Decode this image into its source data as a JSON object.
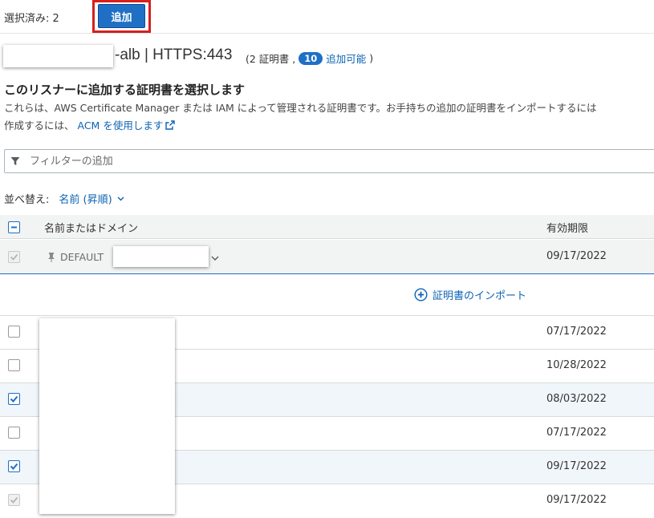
{
  "toolbar": {
    "selected_count": "選択済み: 2",
    "add_label": "追加"
  },
  "listener": {
    "name_suffix": "-alb | HTTPS:443",
    "cert_prefix": "(2 証明書 ,",
    "available_count": "10",
    "available_link": "追加可能",
    "cert_suffix": ")"
  },
  "section": {
    "title": "このリスナーに追加する証明書を選択します",
    "desc_line1": "これらは、AWS Certificate Manager または IAM によって管理される証明書です。お手持ちの追加の証明書をインポートするには",
    "desc_line2_prefix": "作成するには、",
    "acm_link": "ACM を使用します"
  },
  "filter": {
    "placeholder": "フィルターの追加"
  },
  "sort": {
    "label": "並べ替え:",
    "value": "名前 (昇順)"
  },
  "table": {
    "col_name": "名前またはドメイン",
    "col_expiration": "有効期限",
    "default_row": {
      "label": "DEFAULT",
      "expiration": "09/17/2022"
    },
    "import_label": "証明書のインポート",
    "rows": [
      {
        "expiration": "07/17/2022",
        "checked": false,
        "disabled": false
      },
      {
        "expiration": "10/28/2022",
        "checked": false,
        "disabled": false
      },
      {
        "expiration": "08/03/2022",
        "checked": true,
        "disabled": false
      },
      {
        "expiration": "07/17/2022",
        "checked": false,
        "disabled": false
      },
      {
        "expiration": "09/17/2022",
        "checked": true,
        "disabled": false
      },
      {
        "expiration": "09/17/2022",
        "checked": true,
        "disabled": true
      }
    ]
  },
  "colors": {
    "primary": "#1f6fc5",
    "link": "#0d63b3",
    "highlight_border": "#d61f1f",
    "selected_row": "#f1f6fb"
  },
  "icons": {
    "filter": "filter-icon",
    "external_link": "external-link-icon",
    "chevron": "chevron-down-icon",
    "pin": "pin-icon",
    "plus": "plus-circle-icon"
  }
}
